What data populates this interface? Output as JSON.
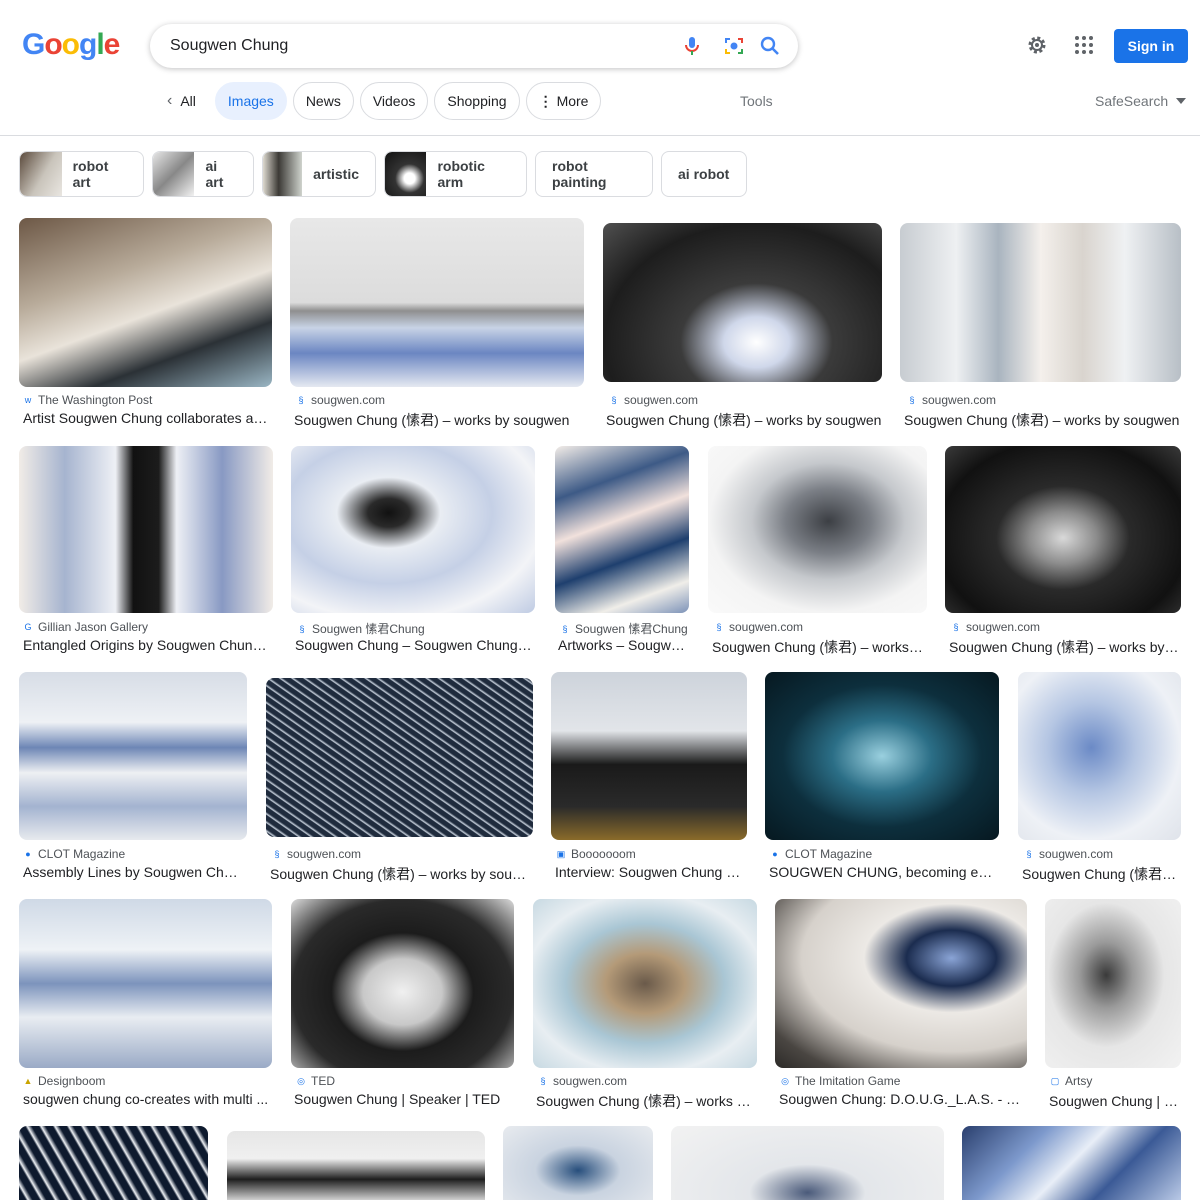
{
  "header": {
    "logo_letters": [
      "G",
      "o",
      "o",
      "g",
      "l",
      "e"
    ],
    "logo_colors": [
      "#4285f4",
      "#ea4335",
      "#fbbc05",
      "#4285f4",
      "#34a853",
      "#ea4335"
    ],
    "search_value": "Sougwen Chung",
    "mic_icon": "mic-icon",
    "lens_icon": "camera-lens-icon",
    "search_icon": "search-icon",
    "settings_icon": "gear-icon",
    "apps_icon": "apps-grid-icon",
    "signin_label": "Sign in"
  },
  "tabs": {
    "all": "All",
    "images": "Images",
    "news": "News",
    "videos": "Videos",
    "shopping": "Shopping",
    "more": "More",
    "tools": "Tools",
    "safesearch": "SafeSearch"
  },
  "chips": [
    "robot art",
    "ai art",
    "artistic",
    "robotic arm",
    "robot painting",
    "ai robot"
  ],
  "results": [
    {
      "source": "The Washington Post",
      "title": "Artist Sougwen Chung collaborates an..."
    },
    {
      "source": "sougwen.com",
      "title": "Sougwen Chung (愫君) – works by sougwen"
    },
    {
      "source": "sougwen.com",
      "title": "Sougwen Chung (愫君) – works by sougwen"
    },
    {
      "source": "sougwen.com",
      "title": "Sougwen Chung (愫君) – works by sougwen"
    },
    {
      "source": "Gillian Jason Gallery",
      "title": "Entangled Origins by Sougwen Chung ..."
    },
    {
      "source": "Sougwen 愫君Chung",
      "title": "Sougwen Chung – Sougwen Chung ..."
    },
    {
      "source": "Sougwen 愫君Chung",
      "title": "Artworks – Sougwe..."
    },
    {
      "source": "sougwen.com",
      "title": "Sougwen Chung (愫君) – works b..."
    },
    {
      "source": "sougwen.com",
      "title": "Sougwen Chung (愫君) – works by s..."
    },
    {
      "source": "CLOT Magazine",
      "title": "Assembly Lines by Sougwen Chung..."
    },
    {
      "source": "sougwen.com",
      "title": "Sougwen Chung (愫君) – works by sougw..."
    },
    {
      "source": "Booooooom",
      "title": "Interview: Sougwen Chung – ..."
    },
    {
      "source": "CLOT Magazine",
      "title": "SOUGWEN CHUNG, becoming entan..."
    },
    {
      "source": "sougwen.com",
      "title": "Sougwen Chung (愫君) ..."
    },
    {
      "source": "Designboom",
      "title": "sougwen chung co-creates with multi ..."
    },
    {
      "source": "TED",
      "title": "Sougwen Chung | Speaker | TED"
    },
    {
      "source": "sougwen.com",
      "title": "Sougwen Chung (愫君) – works by..."
    },
    {
      "source": "The Imitation Game",
      "title": "Sougwen Chung: D.O.U.G._L.A.S. - The ..."
    },
    {
      "source": "Artsy",
      "title": "Sougwen Chung | 肩..."
    }
  ]
}
